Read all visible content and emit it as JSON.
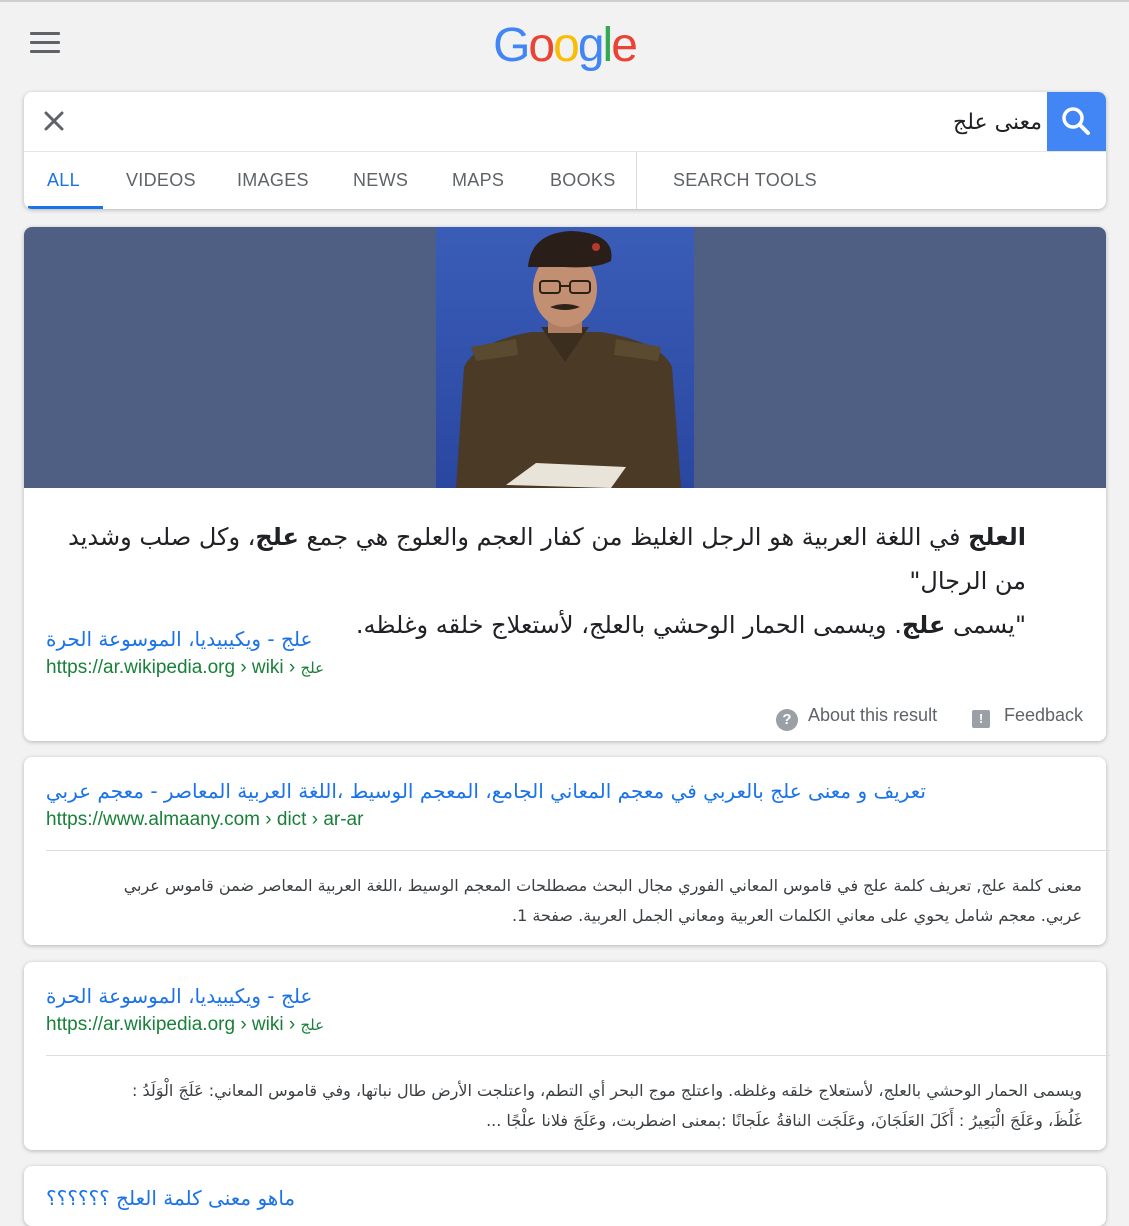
{
  "header": {
    "logo_letters": [
      {
        "ch": "G",
        "color": "#4285F4"
      },
      {
        "ch": "o",
        "color": "#EA4335"
      },
      {
        "ch": "o",
        "color": "#FBBC05"
      },
      {
        "ch": "g",
        "color": "#4285F4"
      },
      {
        "ch": "l",
        "color": "#34A853"
      },
      {
        "ch": "e",
        "color": "#EA4335"
      }
    ],
    "menu_icon": "hamburger-menu-icon"
  },
  "search": {
    "query": "معنى علج",
    "clear_icon": "close-icon",
    "search_icon": "magnifier-icon",
    "accent": "#4285F4"
  },
  "tabs": [
    {
      "label": "ALL",
      "active": true
    },
    {
      "label": "VIDEOS"
    },
    {
      "label": "IMAGES"
    },
    {
      "label": "NEWS"
    },
    {
      "label": "MAPS"
    },
    {
      "label": "BOOKS"
    },
    {
      "label": "SEARCH TOOLS"
    }
  ],
  "featured": {
    "snippet_line1_parts": [
      "العلج",
      " في اللغة العربية هو الرجل الغليظ من كفار العجم والعلوج هي جمع ",
      "علج",
      "، وكل صلب وشديد من الرجال\""
    ],
    "snippet_line2_parts": [
      "\"يسمى ",
      "علج",
      ". ويسمى الحمار الوحشي بالعلج، لأستعلاج خلقه وغلظه."
    ],
    "link_title": "علج - ويكيبيديا، الموسوعة الحرة",
    "url_main": "https://ar.wikipedia.org › wiki › ",
    "url_tail": "علج",
    "about_label": "About this result",
    "feedback_label": "Feedback"
  },
  "results": [
    {
      "title": "تعريف و معنى علج بالعربي في معجم المعاني الجامع، المعجم الوسيط ،اللغة العربية المعاصر - معجم عربي ...",
      "url": "https://www.almaany.com › dict › ar-ar",
      "desc_line1": "معنى كلمة علج, تعريف كلمة علج في قاموس المعاني الفوري مجال البحث مصطلحات المعجم الوسيط ،اللغة العربية المعاصر ضمن قاموس عربي",
      "desc_line2": "عربي. معجم شامل يحوي على معاني الكلمات العربية ومعاني الجمل العربية. صفحة 1."
    },
    {
      "title": "علج - ويكيبيديا، الموسوعة الحرة",
      "url_main": "https://ar.wikipedia.org › wiki › ",
      "url_tail": "علج",
      "desc_line1": "ويسمى الحمار الوحشي بالعلج، لأستعلاج خلقه وغلظه. واعتلج موج البحر أي التطم، واعتلجت الأرض طال نباتها، وفي قاموس المعاني: عَلَجَ الْوَلَدُ :",
      "desc_line2": "غَلُظَ، وعَلَجَ الْبَعِيرُ : أَكَلَ العَلَجَانَ، وعَلَجَت الناقةُ علَجانًا :بمعنى اضطربت، وعَلَجَ فلانا علْجًا ..."
    },
    {
      "title": "ماهو معنى كلمة العلج ؟؟؟؟؟؟"
    }
  ]
}
